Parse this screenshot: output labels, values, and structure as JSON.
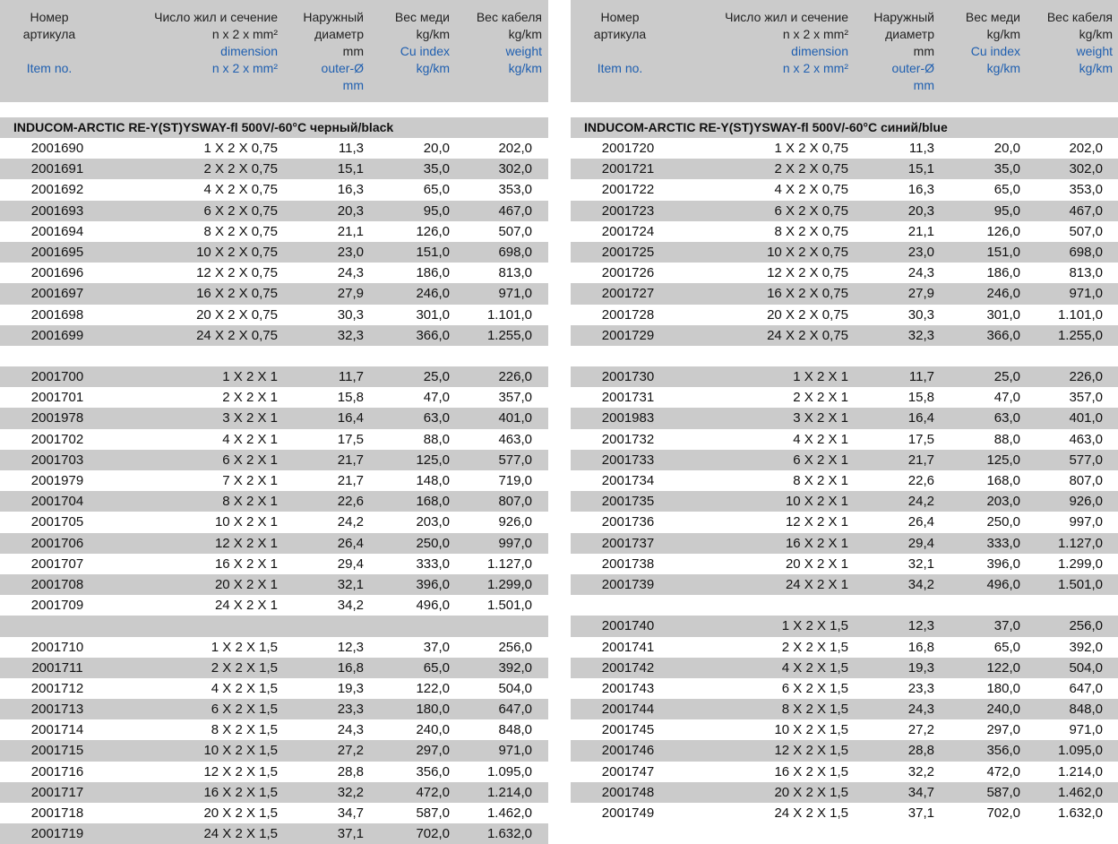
{
  "header": {
    "col1": {
      "ru": [
        "Номер",
        "артикула"
      ],
      "en": [
        "Item no."
      ]
    },
    "col2": {
      "ru": [
        "Число жил и сечение",
        "n x 2 x mm²"
      ],
      "en": [
        "dimension",
        "n x 2 x mm²"
      ]
    },
    "col3": {
      "ru": [
        "Наружный",
        "диаметр",
        "mm"
      ],
      "en": [
        "outer-Ø",
        "mm"
      ]
    },
    "col4": {
      "ru": [
        "Вес меди",
        "kg/km"
      ],
      "en": [
        "Cu index",
        "kg/km"
      ]
    },
    "col5": {
      "ru": [
        "Вес кабеля",
        "kg/km"
      ],
      "en": [
        "weight",
        "kg/km"
      ]
    }
  },
  "left": {
    "title": "INDUCOM-ARCTIC RE-Y(ST)YSWAY-fl 500V/-60°C черный/black",
    "rows": [
      [
        "2001690",
        "1 X 2 X 0,75",
        "11,3",
        "20,0",
        "202,0"
      ],
      [
        "2001691",
        "2 X 2 X 0,75",
        "15,1",
        "35,0",
        "302,0"
      ],
      [
        "2001692",
        "4 X 2 X 0,75",
        "16,3",
        "65,0",
        "353,0"
      ],
      [
        "2001693",
        "6 X 2 X 0,75",
        "20,3",
        "95,0",
        "467,0"
      ],
      [
        "2001694",
        "8 X 2 X 0,75",
        "21,1",
        "126,0",
        "507,0"
      ],
      [
        "2001695",
        "10 X 2 X 0,75",
        "23,0",
        "151,0",
        "698,0"
      ],
      [
        "2001696",
        "12 X 2 X 0,75",
        "24,3",
        "186,0",
        "813,0"
      ],
      [
        "2001697",
        "16 X 2 X 0,75",
        "27,9",
        "246,0",
        "971,0"
      ],
      [
        "2001698",
        "20 X 2 X 0,75",
        "30,3",
        "301,0",
        "1.101,0"
      ],
      [
        "2001699",
        "24 X 2 X 0,75",
        "32,3",
        "366,0",
        "1.255,0"
      ],
      null,
      [
        "2001700",
        "1 X 2 X 1",
        "11,7",
        "25,0",
        "226,0"
      ],
      [
        "2001701",
        "2 X 2 X 1",
        "15,8",
        "47,0",
        "357,0"
      ],
      [
        "2001978",
        "3 X 2 X 1",
        "16,4",
        "63,0",
        "401,0"
      ],
      [
        "2001702",
        "4 X 2 X 1",
        "17,5",
        "88,0",
        "463,0"
      ],
      [
        "2001703",
        "6 X 2 X 1",
        "21,7",
        "125,0",
        "577,0"
      ],
      [
        "2001979",
        "7 X 2 X 1",
        "21,7",
        "148,0",
        "719,0"
      ],
      [
        "2001704",
        "8 X 2 X 1",
        "22,6",
        "168,0",
        "807,0"
      ],
      [
        "2001705",
        "10 X 2 X 1",
        "24,2",
        "203,0",
        "926,0"
      ],
      [
        "2001706",
        "12 X 2 X 1",
        "26,4",
        "250,0",
        "997,0"
      ],
      [
        "2001707",
        "16 X 2 X 1",
        "29,4",
        "333,0",
        "1.127,0"
      ],
      [
        "2001708",
        "20 X 2 X 1",
        "32,1",
        "396,0",
        "1.299,0"
      ],
      [
        "2001709",
        "24 X 2 X 1",
        "34,2",
        "496,0",
        "1.501,0"
      ],
      null,
      [
        "2001710",
        "1 X 2 X 1,5",
        "12,3",
        "37,0",
        "256,0"
      ],
      [
        "2001711",
        "2 X 2 X 1,5",
        "16,8",
        "65,0",
        "392,0"
      ],
      [
        "2001712",
        "4 X 2 X 1,5",
        "19,3",
        "122,0",
        "504,0"
      ],
      [
        "2001713",
        "6 X 2 X 1,5",
        "23,3",
        "180,0",
        "647,0"
      ],
      [
        "2001714",
        "8 X 2 X 1,5",
        "24,3",
        "240,0",
        "848,0"
      ],
      [
        "2001715",
        "10 X 2 X 1,5",
        "27,2",
        "297,0",
        "971,0"
      ],
      [
        "2001716",
        "12 X 2 X 1,5",
        "28,8",
        "356,0",
        "1.095,0"
      ],
      [
        "2001717",
        "16 X 2 X 1,5",
        "32,2",
        "472,0",
        "1.214,0"
      ],
      [
        "2001718",
        "20 X 2 X 1,5",
        "34,7",
        "587,0",
        "1.462,0"
      ],
      [
        "2001719",
        "24 X 2 X 1,5",
        "37,1",
        "702,0",
        "1.632,0"
      ]
    ]
  },
  "right": {
    "title": "INDUCOM-ARCTIC RE-Y(ST)YSWAY-fl 500V/-60°C синий/blue",
    "rows": [
      [
        "2001720",
        "1 X 2 X 0,75",
        "11,3",
        "20,0",
        "202,0"
      ],
      [
        "2001721",
        "2 X 2 X 0,75",
        "15,1",
        "35,0",
        "302,0"
      ],
      [
        "2001722",
        "4 X 2 X 0,75",
        "16,3",
        "65,0",
        "353,0"
      ],
      [
        "2001723",
        "6 X 2 X 0,75",
        "20,3",
        "95,0",
        "467,0"
      ],
      [
        "2001724",
        "8 X 2 X 0,75",
        "21,1",
        "126,0",
        "507,0"
      ],
      [
        "2001725",
        "10 X 2 X 0,75",
        "23,0",
        "151,0",
        "698,0"
      ],
      [
        "2001726",
        "12 X 2 X 0,75",
        "24,3",
        "186,0",
        "813,0"
      ],
      [
        "2001727",
        "16 X 2 X 0,75",
        "27,9",
        "246,0",
        "971,0"
      ],
      [
        "2001728",
        "20 X 2 X 0,75",
        "30,3",
        "301,0",
        "1.101,0"
      ],
      [
        "2001729",
        "24 X 2 X 0,75",
        "32,3",
        "366,0",
        "1.255,0"
      ],
      null,
      [
        "2001730",
        "1 X 2 X 1",
        "11,7",
        "25,0",
        "226,0"
      ],
      [
        "2001731",
        "2 X 2 X 1",
        "15,8",
        "47,0",
        "357,0"
      ],
      [
        "2001983",
        "3 X 2 X 1",
        "16,4",
        "63,0",
        "401,0"
      ],
      [
        "2001732",
        "4 X 2 X 1",
        "17,5",
        "88,0",
        "463,0"
      ],
      [
        "2001733",
        "6 X 2 X 1",
        "21,7",
        "125,0",
        "577,0"
      ],
      [
        "2001734",
        "8 X 2 X 1",
        "22,6",
        "168,0",
        "807,0"
      ],
      [
        "2001735",
        "10 X 2 X 1",
        "24,2",
        "203,0",
        "926,0"
      ],
      [
        "2001736",
        "12 X 2 X 1",
        "26,4",
        "250,0",
        "997,0"
      ],
      [
        "2001737",
        "16 X 2 X 1",
        "29,4",
        "333,0",
        "1.127,0"
      ],
      [
        "2001738",
        "20 X 2 X 1",
        "32,1",
        "396,0",
        "1.299,0"
      ],
      [
        "2001739",
        "24 X 2 X 1",
        "34,2",
        "496,0",
        "1.501,0"
      ],
      null,
      [
        "2001740",
        "1 X 2 X 1,5",
        "12,3",
        "37,0",
        "256,0"
      ],
      [
        "2001741",
        "2 X 2 X 1,5",
        "16,8",
        "65,0",
        "392,0"
      ],
      [
        "2001742",
        "4 X 2 X 1,5",
        "19,3",
        "122,0",
        "504,0"
      ],
      [
        "2001743",
        "6 X 2 X 1,5",
        "23,3",
        "180,0",
        "647,0"
      ],
      [
        "2001744",
        "8 X 2 X 1,5",
        "24,3",
        "240,0",
        "848,0"
      ],
      [
        "2001745",
        "10 X 2 X 1,5",
        "27,2",
        "297,0",
        "971,0"
      ],
      [
        "2001746",
        "12 X 2 X 1,5",
        "28,8",
        "356,0",
        "1.095,0"
      ],
      [
        "2001747",
        "16 X 2 X 1,5",
        "32,2",
        "472,0",
        "1.214,0"
      ],
      [
        "2001748",
        "20 X 2 X 1,5",
        "34,7",
        "587,0",
        "1.462,0"
      ],
      [
        "2001749",
        "24 X 2 X 1,5",
        "37,1",
        "702,0",
        "1.632,0"
      ]
    ]
  }
}
